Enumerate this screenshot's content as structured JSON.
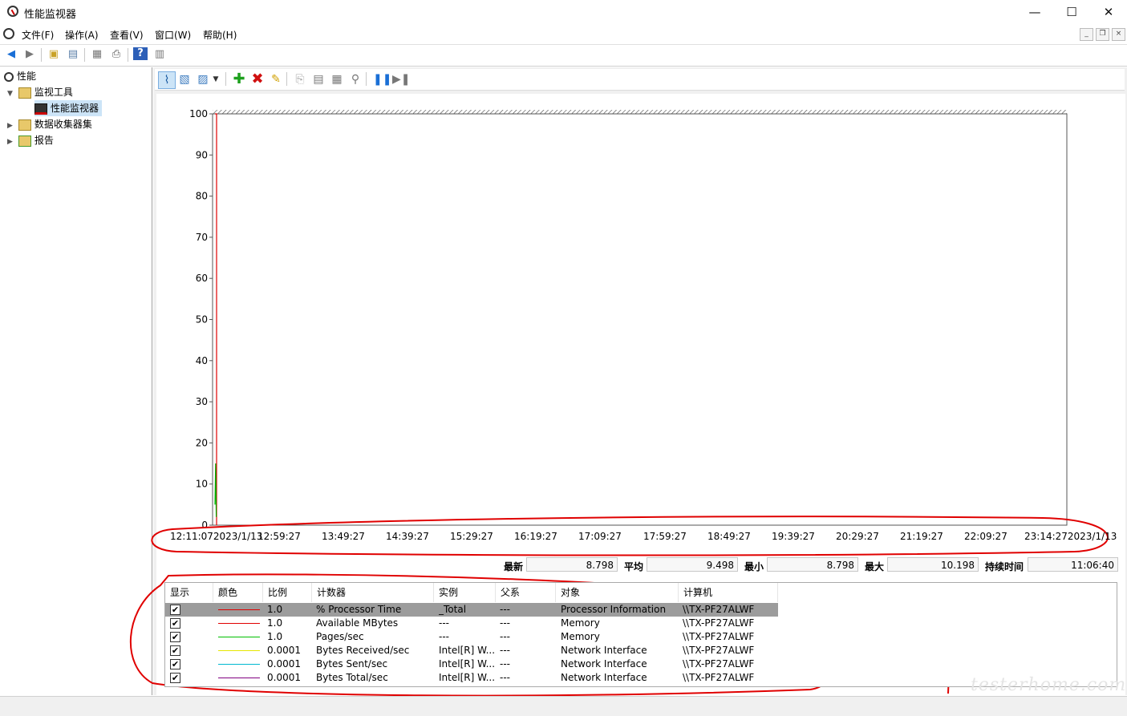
{
  "window": {
    "title": "性能监视器",
    "controls": {
      "minimize": "—",
      "maximize": "☐",
      "close": "✕"
    }
  },
  "menu": [
    "文件(F)",
    "操作(A)",
    "查看(V)",
    "窗口(W)",
    "帮助(H)"
  ],
  "tree": {
    "root": "性能",
    "monitoring_tools": "监视工具",
    "performance_monitor": "性能监视器",
    "data_collector_sets": "数据收集器集",
    "reports": "报告"
  },
  "chart_data": {
    "type": "line",
    "ylim": [
      0,
      100
    ],
    "y_ticks": [
      "100",
      "90",
      "80",
      "70",
      "60",
      "50",
      "40",
      "30",
      "20",
      "10",
      "0"
    ],
    "x_ticks": [
      "12:11:072023/1/13",
      "12:59:27",
      "13:49:27",
      "14:39:27",
      "15:29:27",
      "16:19:27",
      "17:09:27",
      "17:59:27",
      "18:49:27",
      "19:39:27",
      "20:29:27",
      "21:19:27",
      "22:09:27",
      "23:14:272023/1/13"
    ],
    "series": [
      {
        "color": "#e00000",
        "points": [
          [
            0,
            100
          ],
          [
            0.5,
            100
          ],
          [
            0.5,
            0
          ]
        ]
      },
      {
        "color": "#00b000",
        "points": [
          [
            0,
            5
          ],
          [
            0.2,
            15
          ],
          [
            0.4,
            2
          ]
        ]
      }
    ]
  },
  "stats": {
    "latest_label": "最新",
    "latest": "8.798",
    "average_label": "平均",
    "average": "9.498",
    "min_label": "最小",
    "min": "8.798",
    "max_label": "最大",
    "max": "10.198",
    "duration_label": "持续时间",
    "duration": "11:06:40"
  },
  "table": {
    "headers": [
      "显示",
      "颜色",
      "比例",
      "计数器",
      "实例",
      "父系",
      "对象",
      "计算机"
    ],
    "rows": [
      {
        "show": "✔",
        "color": "#e00000",
        "scale": "1.0",
        "counter": "% Processor Time",
        "instance": "_Total",
        "parent": "---",
        "object": "Processor Information",
        "computer": "\\\\TX-PF27ALWF"
      },
      {
        "show": "✔",
        "color": "#e00000",
        "scale": "1.0",
        "counter": "Available MBytes",
        "instance": "---",
        "parent": "---",
        "object": "Memory",
        "computer": "\\\\TX-PF27ALWF"
      },
      {
        "show": "✔",
        "color": "#00c000",
        "scale": "1.0",
        "counter": "Pages/sec",
        "instance": "---",
        "parent": "---",
        "object": "Memory",
        "computer": "\\\\TX-PF27ALWF"
      },
      {
        "show": "✔",
        "color": "#e6e600",
        "scale": "0.0001",
        "counter": "Bytes Received/sec",
        "instance": "Intel[R] W...",
        "parent": "---",
        "object": "Network Interface",
        "computer": "\\\\TX-PF27ALWF"
      },
      {
        "show": "✔",
        "color": "#00b8d0",
        "scale": "0.0001",
        "counter": "Bytes Sent/sec",
        "instance": "Intel[R] W...",
        "parent": "---",
        "object": "Network Interface",
        "computer": "\\\\TX-PF27ALWF"
      },
      {
        "show": "✔",
        "color": "#800080",
        "scale": "0.0001",
        "counter": "Bytes Total/sec",
        "instance": "Intel[R] W...",
        "parent": "---",
        "object": "Network Interface",
        "computer": "\\\\TX-PF27ALWF"
      }
    ]
  },
  "watermark": "testerhome.com"
}
